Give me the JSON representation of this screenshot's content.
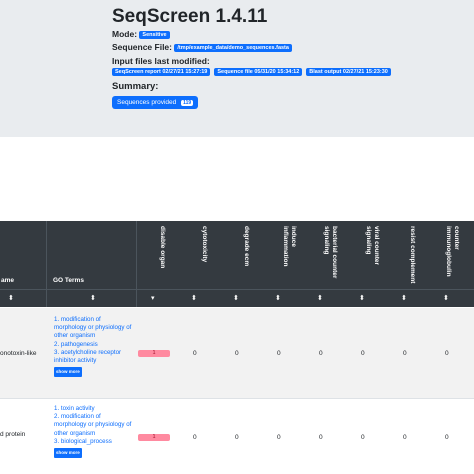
{
  "header": {
    "title": "SeqScreen 1.4.11",
    "mode_label": "Mode:",
    "mode_value": "Sensitive",
    "seqfile_label": "Sequence File:",
    "seqfile_value": "/tmp/example_data/demo_sequences.fasta",
    "modified_label": "Input files last modified:",
    "modified_pills": [
      "SeqScreen report 02/27/21 15:27:19",
      "Sequence file 05/31/20 15:34:12",
      "Blast output 02/27/21 15:23:30"
    ],
    "summary_label": "Summary:",
    "sequences_button_label": "Sequences provided",
    "sequences_count": "119"
  },
  "table": {
    "name_header": "ame",
    "go_header": "GO Terms",
    "columns": [
      "disable organ",
      "cytotoxicity",
      "degrade ecm",
      "induce inflammation",
      "bacterial counter signaling",
      "viral counter signaling",
      "resist complement",
      "counter immunoglobulin"
    ],
    "sort_icon": "⬍",
    "sorted_icon": "▾",
    "rows": [
      {
        "name": "onotoxin-like",
        "go_terms": [
          "1. modification of morphology or physiology of other organism",
          "2. pathogenesis",
          "3. acetylcholine receptor inhibitor activity"
        ],
        "show_more": "show more",
        "disable_organ": "1",
        "values": [
          "0",
          "0",
          "0",
          "0",
          "0",
          "0",
          "0"
        ]
      },
      {
        "name": "d protein",
        "go_terms": [
          "1. toxin activity",
          "2. modification of morphology or physiology of other organism",
          "3. biological_process"
        ],
        "show_more": "show more",
        "disable_organ": "1",
        "values": [
          "0",
          "0",
          "0",
          "0",
          "0",
          "0",
          "0"
        ]
      }
    ]
  },
  "colors": {
    "header_bg": "#e9ecef",
    "table_header_bg": "#343a40",
    "accent": "#0d6efd",
    "disable_bar": "#ff8aa0"
  }
}
